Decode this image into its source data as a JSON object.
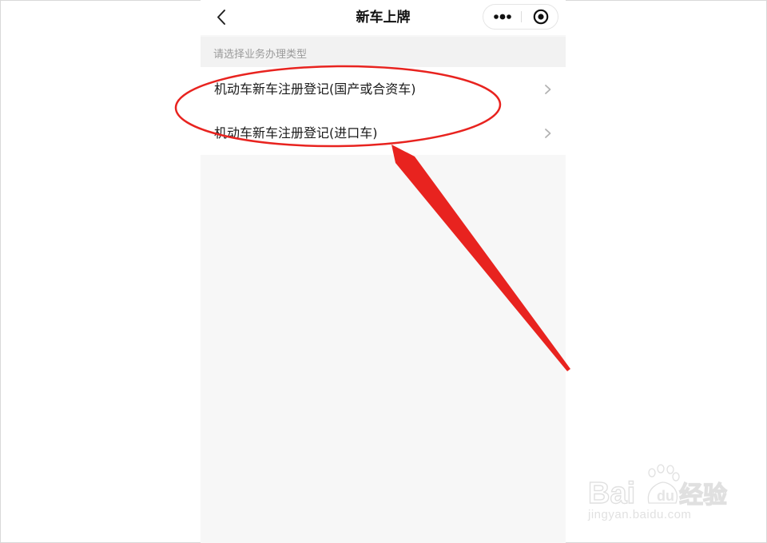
{
  "navbar": {
    "title": "新车上牌",
    "back_icon": "chevron-left-icon",
    "more_icon": "more-dots-icon",
    "close_icon": "target-close-icon"
  },
  "section": {
    "label": "请选择业务办理类型"
  },
  "items": [
    {
      "label": "机动车新车注册登记(国产或合资车)",
      "icon": "chevron-right-icon"
    },
    {
      "label": "机动车新车注册登记(进口车)",
      "icon": "chevron-right-icon"
    }
  ],
  "annotation": {
    "color": "#e8231f"
  },
  "watermark": {
    "logo_text": "Baidu经验",
    "url": "jingyan.baidu.com"
  },
  "colors": {
    "page_bg": "#f7f7f7",
    "annotation_red": "#e8231f"
  }
}
